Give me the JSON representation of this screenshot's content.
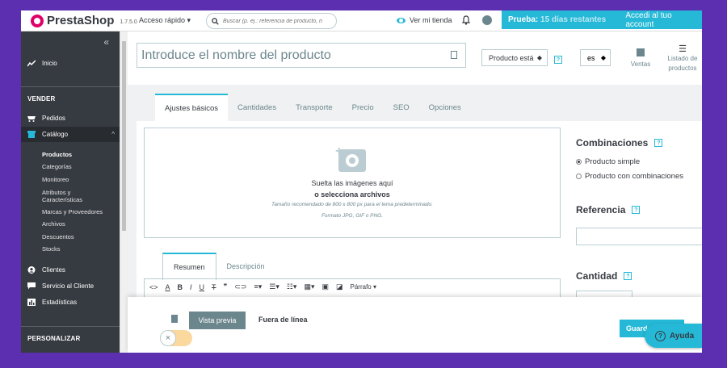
{
  "header": {
    "brand": "PrestaShop",
    "version": "1.7.5.0",
    "quick_access": "Acceso rápido ▾",
    "search_placeholder": "Buscar (p. ej.: referencia de producto, n",
    "view_shop": "Ver mi tienda",
    "trial_label": "Prueba:",
    "trial_remaining": "15 días restantes",
    "account_link": "Accedi al tuo account"
  },
  "sidebar": {
    "collapse": "«",
    "dashboard": "Inicio",
    "section_sell": "VENDER",
    "orders": "Pedidos",
    "catalog": "Catálogo",
    "catalog_caret": "^",
    "catalog_items": [
      "Productos",
      "Categorías",
      "Monitoreo",
      "Atributos y Características",
      "Marcas y Proveedores",
      "Archivos",
      "Descuentos",
      "Stocks"
    ],
    "customers": "Clientes",
    "customer_service": "Servicio al Cliente",
    "stats": "Estadísticas",
    "section_customize": "PERSONALIZAR"
  },
  "product": {
    "name_placeholder": "Introduce el nombre del producto",
    "type_select": "Producto está",
    "language": "es",
    "sales": "Ventas",
    "listing": "Listado de productos"
  },
  "tabs": [
    "Ajustes básicos",
    "Cantidades",
    "Transporte",
    "Precio",
    "SEO",
    "Opciones"
  ],
  "dropzone": {
    "line1": "Suelta las imágenes aquí",
    "line2": "o selecciona archivos",
    "line3": "Tamaño recomendado de 800 x 800 px para el tema predeterminado.",
    "line4": "Formato JPG, GIF o PNG."
  },
  "right": {
    "combinations": "Combinaciones",
    "simple": "Producto simple",
    "with_combinations": "Producto con combinaciones",
    "reference": "Referencia",
    "quantity": "Cantidad"
  },
  "description_tabs": [
    "Resumen",
    "Descripción"
  ],
  "editor": {
    "paragraph": "Párrafo ▾"
  },
  "footer": {
    "preview": "Vista previa",
    "offline": "Fuera de línea",
    "save": "Guard",
    "help": "Ayuda",
    "toggle_icon": "×"
  }
}
